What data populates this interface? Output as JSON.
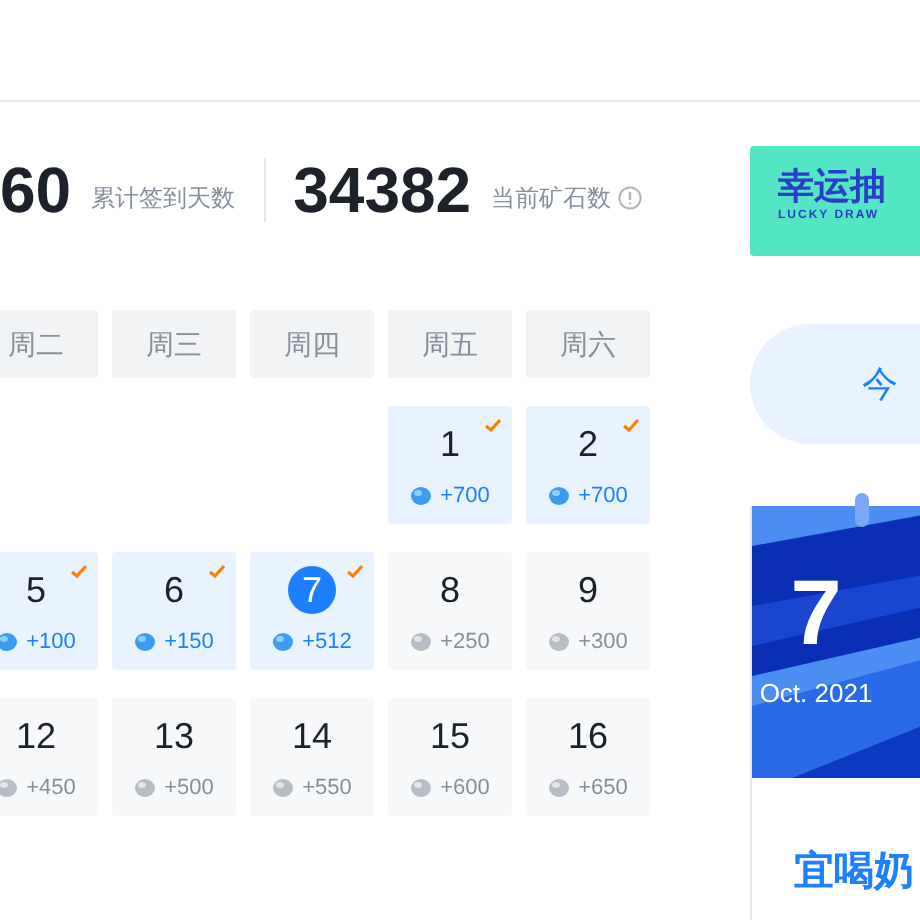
{
  "stats": [
    {
      "value": "60",
      "label": "累计签到天数",
      "info": false
    },
    {
      "value": "34382",
      "label": "当前矿石数",
      "info": true
    }
  ],
  "banner": {
    "title": "幸运抽",
    "subtitle": "LUCKY DRAW"
  },
  "sign_button": {
    "label": "今"
  },
  "weekdays": [
    "周二",
    "周三",
    "周四",
    "周五",
    "周六"
  ],
  "weeks": [
    [
      {
        "kind": "blank"
      },
      {
        "kind": "blank"
      },
      {
        "kind": "blank"
      },
      {
        "kind": "day",
        "day": "1",
        "reward": "+700",
        "signed": true,
        "today": false
      },
      {
        "kind": "day",
        "day": "2",
        "reward": "+700",
        "signed": true,
        "today": false
      }
    ],
    [
      {
        "kind": "day",
        "day": "5",
        "reward": "+100",
        "signed": true,
        "today": false
      },
      {
        "kind": "day",
        "day": "6",
        "reward": "+150",
        "signed": true,
        "today": false
      },
      {
        "kind": "day",
        "day": "7",
        "reward": "+512",
        "signed": true,
        "today": true
      },
      {
        "kind": "day",
        "day": "8",
        "reward": "+250",
        "signed": false,
        "today": false
      },
      {
        "kind": "day",
        "day": "9",
        "reward": "+300",
        "signed": false,
        "today": false
      }
    ],
    [
      {
        "kind": "day",
        "day": "12",
        "reward": "+450",
        "signed": false,
        "today": false
      },
      {
        "kind": "day",
        "day": "13",
        "reward": "+500",
        "signed": false,
        "today": false
      },
      {
        "kind": "day",
        "day": "14",
        "reward": "+550",
        "signed": false,
        "today": false
      },
      {
        "kind": "day",
        "day": "15",
        "reward": "+600",
        "signed": false,
        "today": false
      },
      {
        "kind": "day",
        "day": "16",
        "reward": "+650",
        "signed": false,
        "today": false
      }
    ]
  ],
  "date_card": {
    "day": "7",
    "month_year": "Oct. 2021",
    "advice": "宜喝奶"
  }
}
